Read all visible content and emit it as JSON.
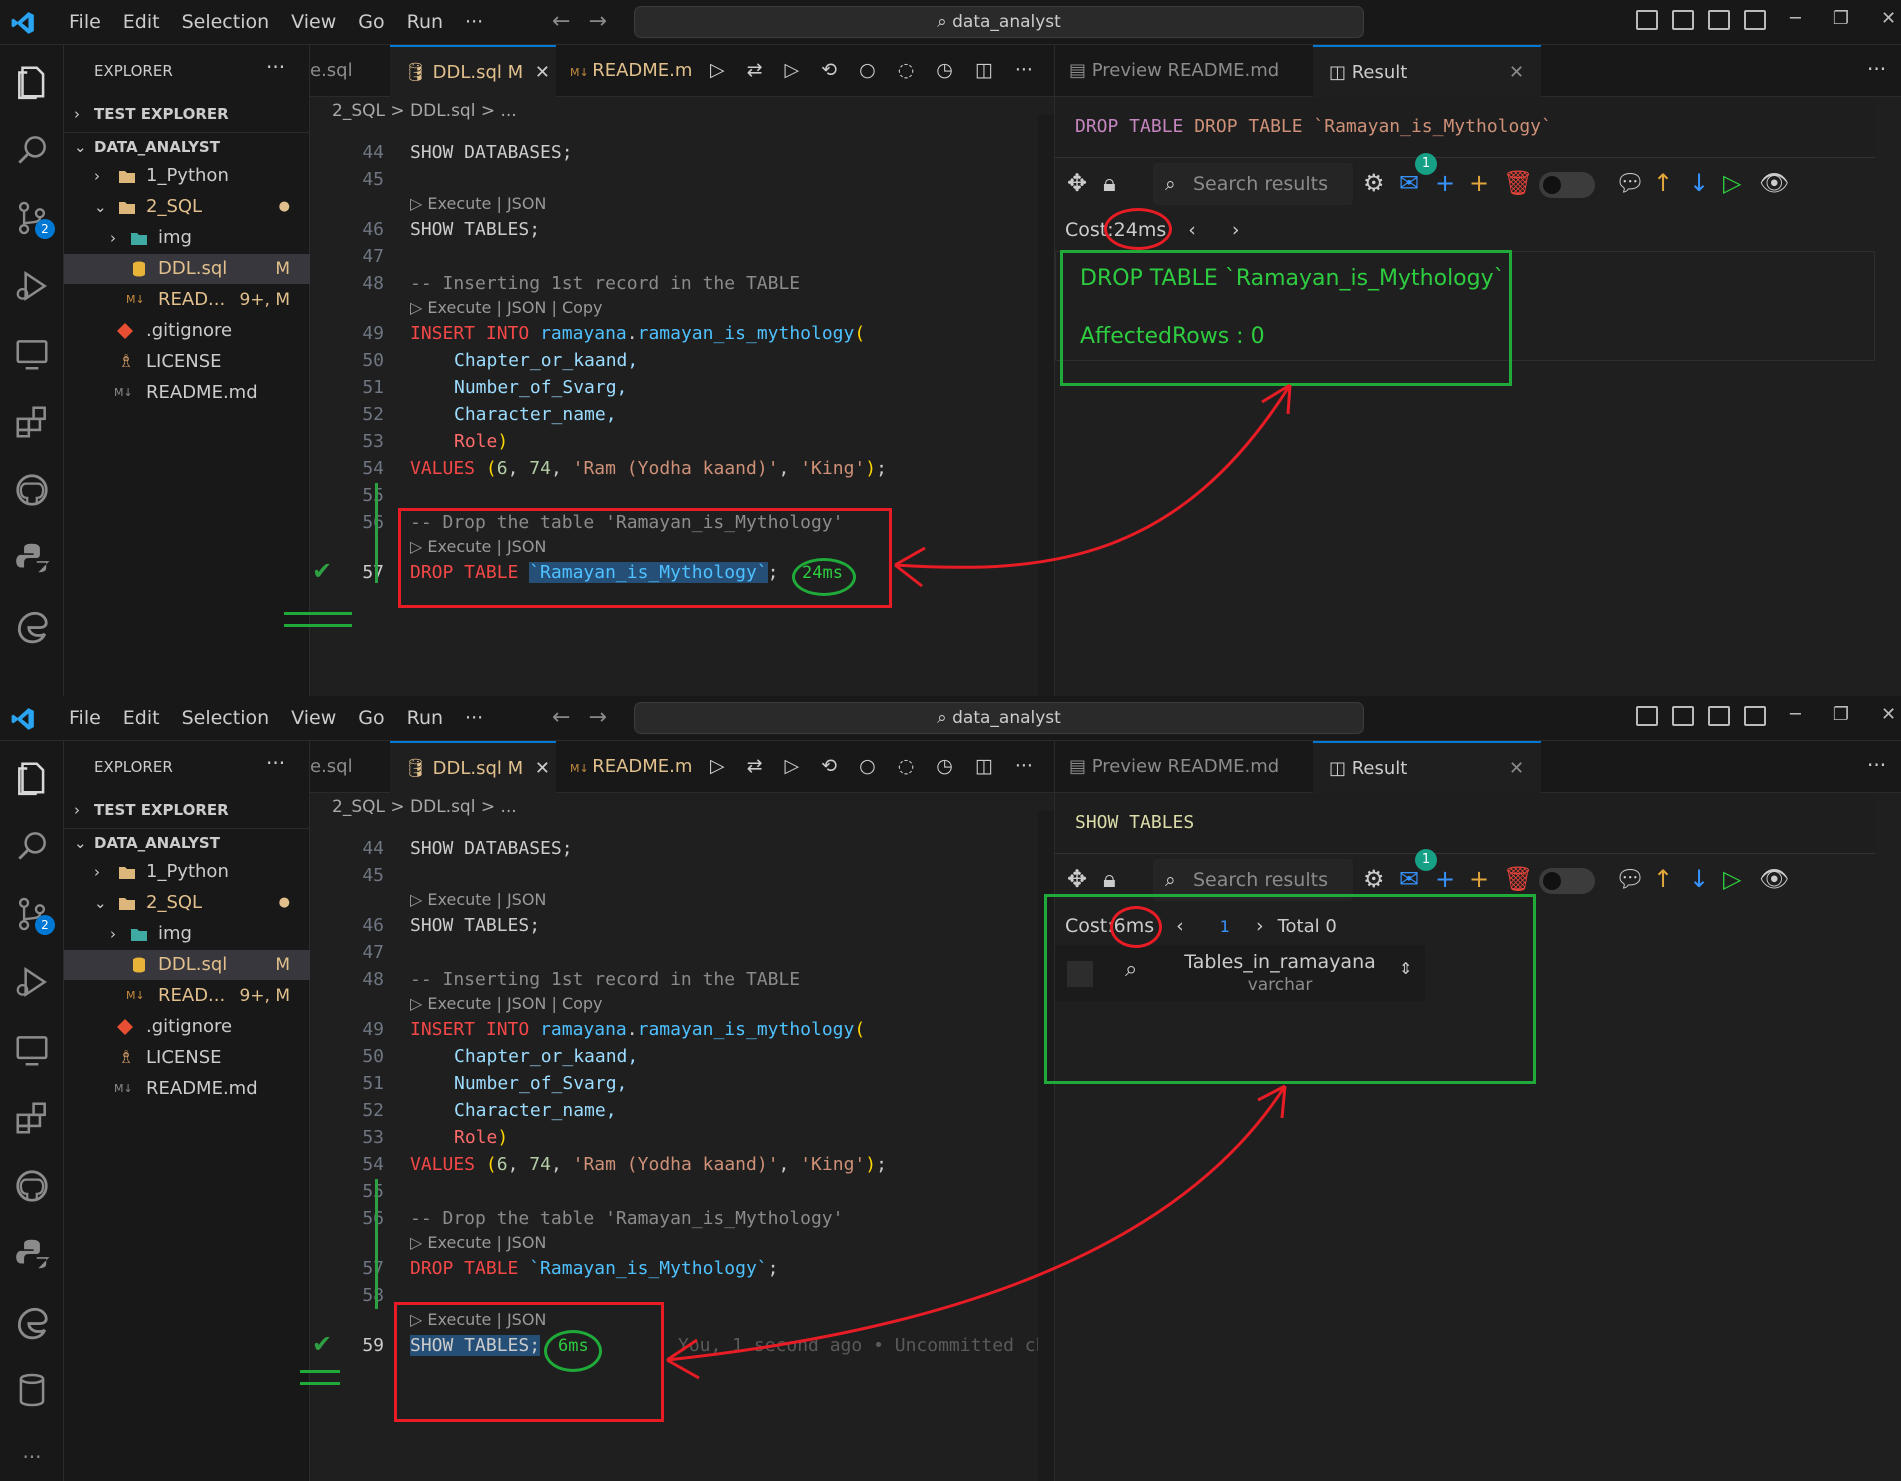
{
  "menu": [
    "File",
    "Edit",
    "Selection",
    "View",
    "Go",
    "Run",
    "···"
  ],
  "command_center": "data_analyst",
  "explorer": {
    "title": "EXPLORER",
    "dots": "···",
    "test_explorer": "TEST EXPLORER",
    "root": "DATA_ANALYST",
    "items": [
      {
        "label": "1_Python",
        "status": ""
      },
      {
        "label": "2_SQL",
        "status": "●"
      },
      {
        "label": "img",
        "status": ""
      },
      {
        "label": "DDL.sql",
        "status": "M"
      },
      {
        "label": "READ...",
        "status": "9+, M"
      },
      {
        "label": ".gitignore",
        "status": ""
      },
      {
        "label": "LICENSE",
        "status": ""
      },
      {
        "label": "README.md",
        "status": ""
      }
    ]
  },
  "editor": {
    "tab_prev": "e.sql",
    "tab_active": "DDL.sql",
    "tab_active_status": "M",
    "tab_readme": "README.m",
    "breadcrumb": "2_SQL  >  DDL.sql  >  ...",
    "lens_execute_json": "Execute | JSON",
    "lens_execute_json_copy": "Execute | JSON | Copy",
    "lines": {
      "l44": "SHOW DATABASES;",
      "l46": "SHOW TABLES;",
      "l48": "-- Inserting 1st record in the TABLE",
      "l49a": "INSERT INTO",
      "l49b": "ramayana",
      "l49c": "ramayan_is_mythology",
      "l50": "Chapter_or_kaand,",
      "l51": "Number_of_Svarg,",
      "l52": "Character_name,",
      "l53": "Role",
      "l54a": "VALUES",
      "l54b": "6",
      "l54c": "74",
      "l54d": "'Ram (Yodha kaand)'",
      "l54e": "'King'",
      "l56": "-- Drop the table 'Ramayan_is_Mythology'",
      "l57a": "DROP TABLE",
      "l57b": "`Ramayan_is_Mythology`",
      "l59": "SHOW TABLES;"
    },
    "line_numbers_top": [
      "44",
      "45",
      "46",
      "47",
      "48",
      "49",
      "50",
      "51",
      "52",
      "53",
      "54",
      "55",
      "56",
      "57"
    ],
    "line_numbers_bottom": [
      "44",
      "45",
      "46",
      "47",
      "48",
      "49",
      "50",
      "51",
      "52",
      "53",
      "54",
      "55",
      "56",
      "57",
      "58",
      "59"
    ],
    "timing_top": "24ms",
    "timing_bottom": "6ms",
    "blame": "You, 1 second ago • Uncommitted ch"
  },
  "result": {
    "tab_preview": "Preview README.md",
    "tab_result": "Result",
    "close": "✕",
    "search_placeholder": "Search results",
    "mail_badge": "1",
    "top": {
      "query": "DROP TABLE `Ramayan_is_Mythology`",
      "cost_label": "Cost:",
      "cost_value": "24ms",
      "result_line1": "DROP TABLE `Ramayan_is_Mythology`",
      "result_line2": "AffectedRows : 0"
    },
    "bottom": {
      "query": "SHOW TABLES",
      "cost_label": "Cost:",
      "cost_value": "6ms",
      "page": "1",
      "total": "Total 0",
      "column_name": "Tables_in_ramayana",
      "column_type": "varchar"
    }
  },
  "colors": {
    "annotation_red": "#e81c24",
    "annotation_green": "#1faa3a",
    "accent": "#0078d4"
  }
}
